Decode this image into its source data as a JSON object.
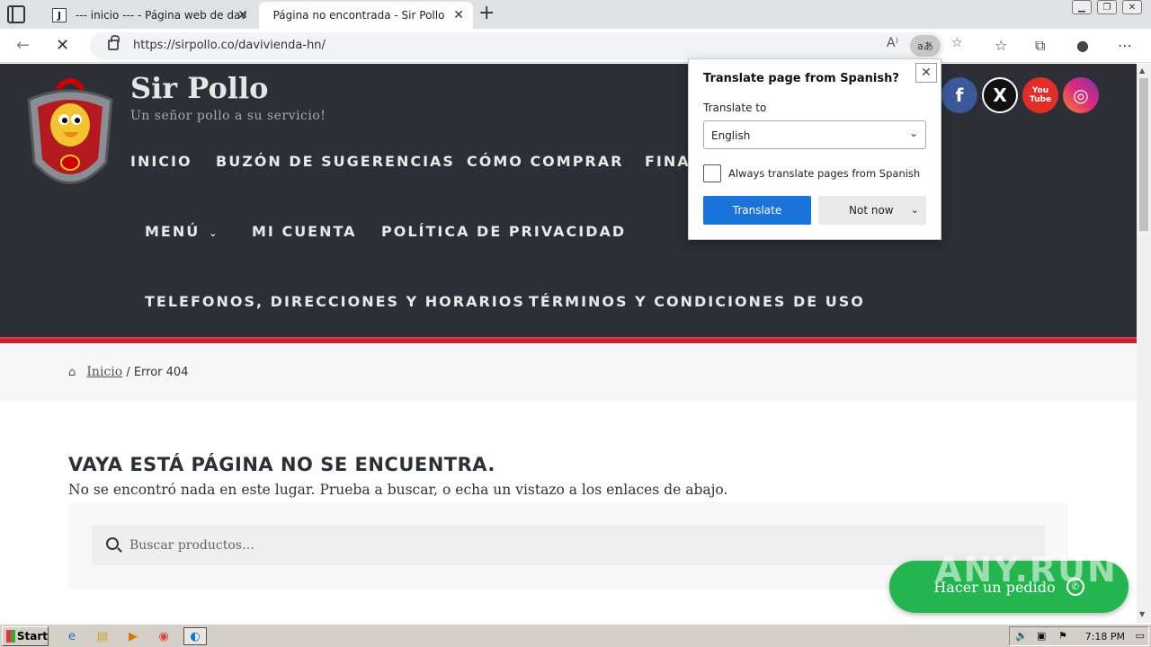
{
  "browser": {
    "tabs": [
      {
        "favicon": "J",
        "title": "--- inicio --- - Página web de dav"
      },
      {
        "title": "Página no encontrada - Sir Pollo"
      }
    ],
    "url": "https://sirpollo.co/davivienda-hn/",
    "translate_indicator": "aあ"
  },
  "site": {
    "title": "Sir Pollo",
    "tagline": "Un señor pollo a su servicio!",
    "menu": [
      "INICIO",
      "BUZÓN DE SUGERENCIAS",
      "CÓMO COMPRAR",
      "FINA",
      "MENÚ",
      "MI CUENTA",
      "POLÍTICA DE PRIVACIDAD",
      "TELEFONOS, DIRECCIONES Y HORARIOS",
      "TÉRMINOS Y CONDICIONES DE USO"
    ],
    "social": [
      {
        "name": "facebook-icon",
        "glyph": "f",
        "color": "#3b5998"
      },
      {
        "name": "x-icon",
        "glyph": "X",
        "color": "#111111"
      },
      {
        "name": "youtube-icon",
        "glyph": "You\nTube",
        "color": "#e52d27"
      },
      {
        "name": "instagram-icon",
        "glyph": "◎",
        "color": "#c13584"
      }
    ]
  },
  "breadcrumb": {
    "home": "Inicio",
    "current": "/ Error 404"
  },
  "content": {
    "title": "VAYA ESTÁ PÁGINA NO SE ENCUENTRA.",
    "text": "No se encontró nada en este lugar. Prueba a buscar, o echa un vistazo a los enlaces de abajo.",
    "search_placeholder": "Buscar productos…"
  },
  "whatsapp": {
    "label": "Hacer un pedido"
  },
  "watermark": "ANY.RUN",
  "translate_popup": {
    "title": "Translate page from Spanish?",
    "label": "Translate to",
    "selected_language": "English",
    "always_label": "Always translate pages from Spanish",
    "always_checked": false,
    "translate_button": "Translate",
    "not_now_button": "Not now"
  },
  "taskbar": {
    "start": "Start",
    "clock": "7:18 PM"
  },
  "colors": {
    "header_bg": "#2d2e36",
    "accent_red": "#c0262d",
    "whatsapp_green": "#25b54f",
    "translate_blue": "#1a73d9"
  }
}
